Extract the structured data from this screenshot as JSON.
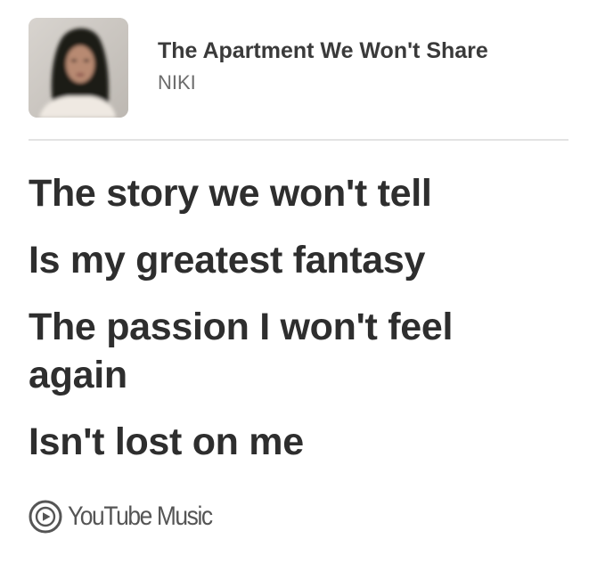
{
  "song": {
    "title": "The Apartment We Won't Share",
    "artist": "NIKI"
  },
  "lyrics": {
    "line_1": "The story we won't tell",
    "line_2": "Is my greatest fantasy",
    "line_3": "The passion I won't feel again",
    "line_4": "Isn't lost on me"
  },
  "brand": {
    "name": "YouTube Music",
    "icon": "youtube-music-play-icon"
  },
  "colors": {
    "background": "#ffffff",
    "lyric_text": "#2e2e2e",
    "title_text": "#3a3a3a",
    "artist_text": "#6c6c6c",
    "brand_text": "#555555",
    "divider": "#e3e3e3"
  }
}
